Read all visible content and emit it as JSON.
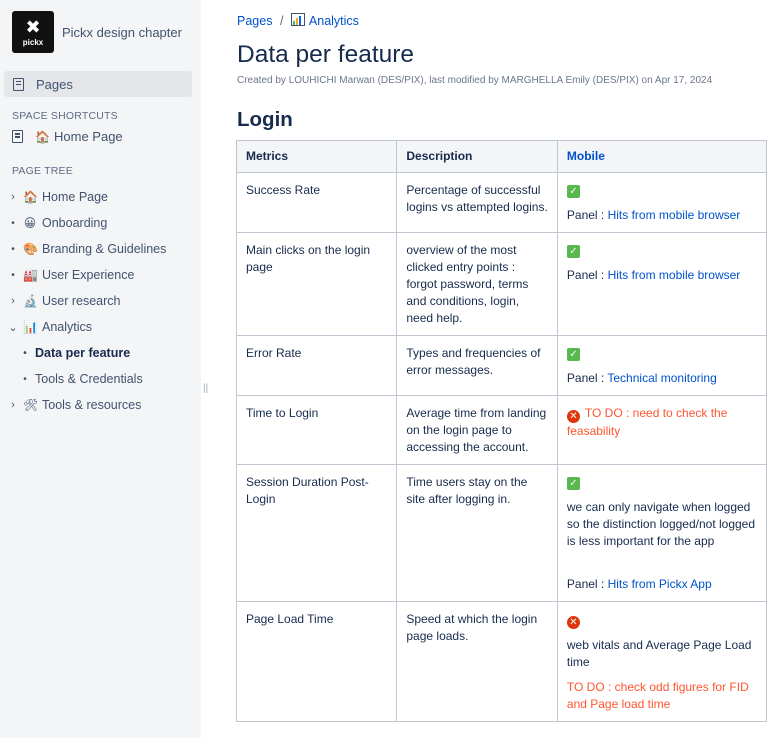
{
  "space": {
    "logo_mark": "✖",
    "logo_word": "pickx",
    "name": "Pickx design chapter"
  },
  "sidebar": {
    "pages_label": "Pages",
    "shortcuts_title": "SPACE SHORTCUTS",
    "shortcut_home": "Home Page",
    "tree_title": "PAGE TREE",
    "tree": [
      {
        "label": "Home Page",
        "icon": "🏠"
      },
      {
        "label": "Onboarding",
        "icon": "😀"
      },
      {
        "label": "Branding & Guidelines",
        "icon": "🎨"
      },
      {
        "label": "User Experience",
        "icon": "🏭"
      },
      {
        "label": "User research",
        "icon": "🔬"
      },
      {
        "label": "Analytics",
        "icon": "📊"
      },
      {
        "label": "Data per feature"
      },
      {
        "label": "Tools & Credentials"
      },
      {
        "label": "Tools & resources",
        "icon": "🛠"
      }
    ]
  },
  "breadcrumb": {
    "root": "Pages",
    "separator": "/",
    "current": "Analytics"
  },
  "page": {
    "title": "Data per feature",
    "byline": "Created by LOUHICHI Marwan (DES/PIX), last modified by MARGHELLA Emily (DES/PIX) on Apr 17, 2024",
    "section_title": "Login"
  },
  "table": {
    "headers": [
      "Metrics",
      "Description",
      "Mobile"
    ],
    "rows": [
      {
        "metric": "Success Rate",
        "description": "Percentage of successful logins vs attempted logins.",
        "panel_prefix": "Panel : ",
        "panel_link": "Hits from mobile browser"
      },
      {
        "metric": "Main clicks on the login page",
        "description": "overview of the most clicked entry points : forgot password, terms and conditions, login, need help.",
        "panel_prefix": "Panel : ",
        "panel_link": "Hits from mobile browser"
      },
      {
        "metric": "Error Rate",
        "description": "Types and frequencies of error messages.",
        "panel_prefix": "Panel : ",
        "panel_link": "Technical monitoring"
      },
      {
        "metric": "Time to Login",
        "description": "Average time from landing on the login page to accessing the account.",
        "todo": "TO DO : need to check the feasability"
      },
      {
        "metric": "Session Duration Post-Login",
        "description": "Time users stay on the site after logging in.",
        "note": "we can only navigate when logged so the distinction logged/not logged is less important for the app",
        "panel_prefix": "Panel : ",
        "panel_link": "Hits from Pickx App"
      },
      {
        "metric": "Page Load Time",
        "description": "Speed at which the login page loads.",
        "note": "web vitals and Average Page Load time",
        "todo": "TO DO : check odd figures for FID and Page load time"
      }
    ]
  },
  "colors": {
    "link": "#0052cc",
    "todo": "#ff5630",
    "check": "#57b84d",
    "cross": "#de350b",
    "sidebar_bg": "#f4f5f7"
  }
}
